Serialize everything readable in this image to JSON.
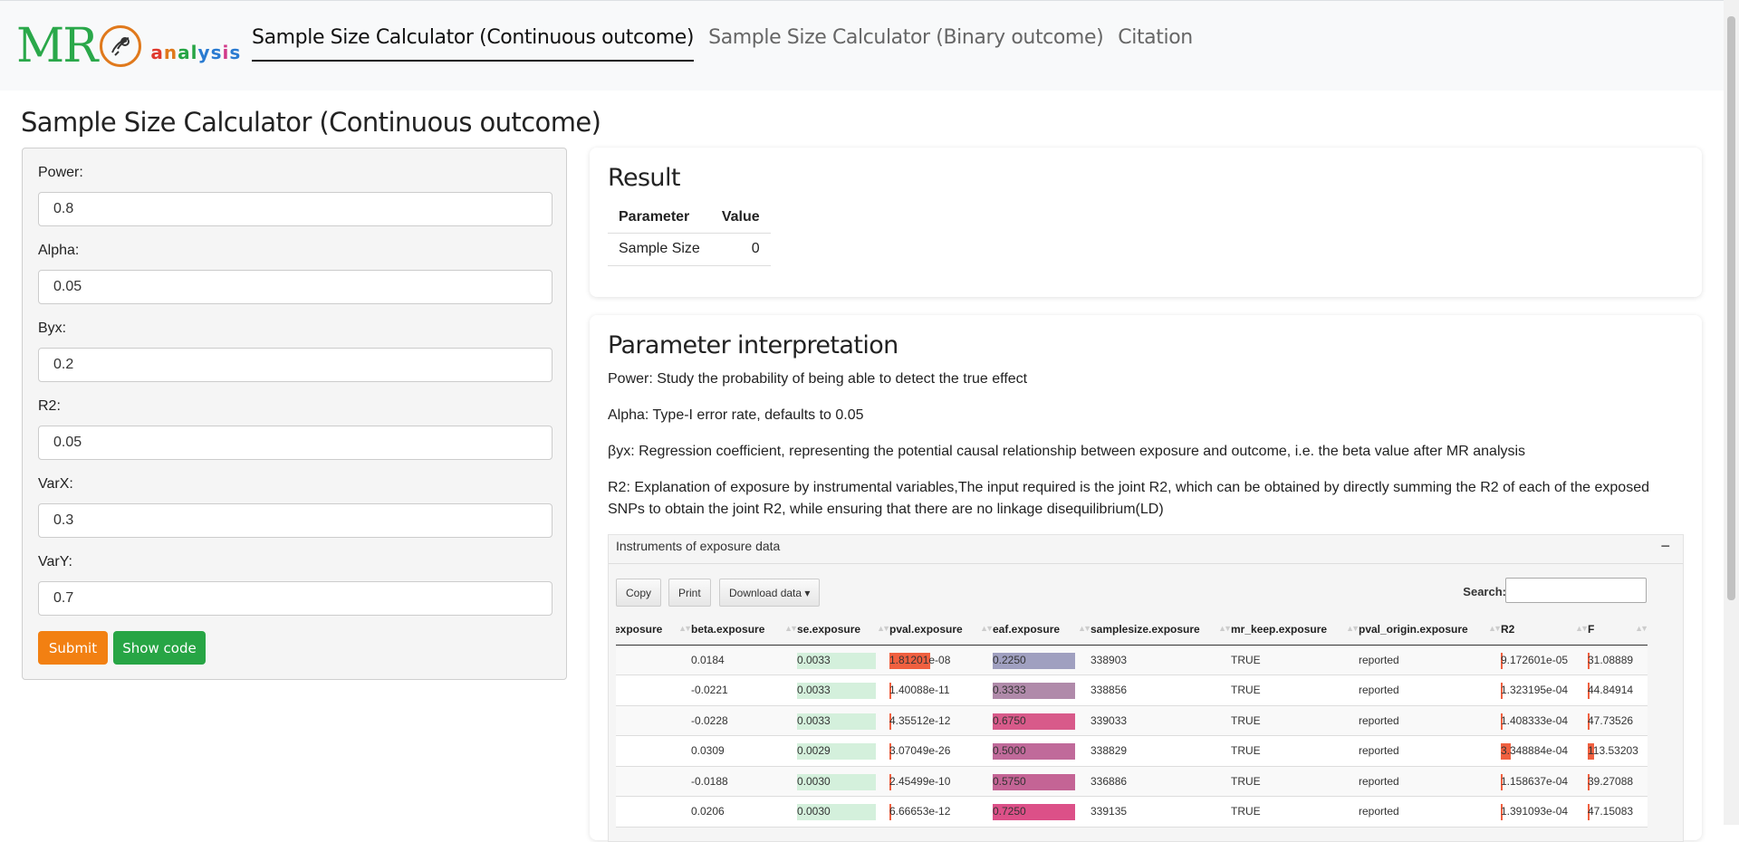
{
  "logo": {
    "mr": "MR",
    "symbol": "⚲",
    "analysis_letters": [
      "a",
      "n",
      "a",
      "l",
      "y",
      "s",
      "i",
      "s"
    ],
    "analysis_colors": [
      "#e03a2f",
      "#e0791c",
      "#27a545",
      "#27a545",
      "#2a7bd1",
      "#2a7bd1",
      "#d13a8a",
      "#2a7bd1"
    ]
  },
  "nav": {
    "items": [
      "Sample Size Calculator (Continuous outcome)",
      "Sample Size Calculator (Binary outcome)",
      "Citation"
    ],
    "active": 0
  },
  "page_title": "Sample Size Calculator (Continuous outcome)",
  "form": {
    "fields": [
      {
        "label": "Power:",
        "value": "0.8"
      },
      {
        "label": "Alpha:",
        "value": "0.05"
      },
      {
        "label": "Byx:",
        "value": "0.2"
      },
      {
        "label": "R2:",
        "value": "0.05"
      },
      {
        "label": "VarX:",
        "value": "0.3"
      },
      {
        "label": "VarY:",
        "value": "0.7"
      }
    ],
    "submit_label": "Submit",
    "show_code_label": "Show code",
    "submit_color": "#f28012",
    "show_code_color": "#27a545"
  },
  "result": {
    "title": "Result",
    "headers": [
      "Parameter",
      "Value"
    ],
    "rows": [
      [
        "Sample Size",
        "0"
      ]
    ]
  },
  "interpretation": {
    "title": "Parameter interpretation",
    "paragraphs": [
      "Power: Study the probability of being able to detect the true effect",
      "Alpha: Type-I error rate, defaults to 0.05",
      "βyx: Regression coefficient, representing the potential causal relationship between exposure and outcome, i.e. the beta value after MR analysis",
      "R2: Explanation of exposure by instrumental variables,The input required is the joint R2, which can be obtained by directly summing the R2 of each of the exposed SNPs to obtain the joint R2, while ensuring that there are no linkage disequilibrium(LD)"
    ]
  },
  "instruments": {
    "panel_title": "Instruments of exposure data",
    "collapse_symbol": "−",
    "buttons": [
      "Copy",
      "Print",
      "Download data ▾"
    ],
    "search_label": "Search:",
    "columns": [
      "exposure",
      "beta.exposure",
      "se.exposure",
      "pval.exposure",
      "eaf.exposure",
      "samplesize.exposure",
      "mr_keep.exposure",
      "pval_origin.exposure",
      "R2",
      "F"
    ],
    "rows": [
      {
        "exposure": "",
        "beta": "0.0184",
        "se": "0.0033",
        "pval": "1.81201e-08",
        "pval_level": 0.45,
        "eaf": "0.2250",
        "eaf_color": "#a0a0c0",
        "samplesize": "338903",
        "mr_keep": "TRUE",
        "pval_origin": "reported",
        "r2": "9.172601e-05",
        "r2_level": 0.01,
        "f": "31.08889",
        "f_level": 0.02
      },
      {
        "exposure": "",
        "beta": "-0.0221",
        "se": "0.0033",
        "pval": "1.40088e-11",
        "pval_level": 0.02,
        "eaf": "0.3333",
        "eaf_color": "#b08aaa",
        "samplesize": "338856",
        "mr_keep": "TRUE",
        "pval_origin": "reported",
        "r2": "1.323195e-04",
        "r2_level": 0.02,
        "f": "44.84914",
        "f_level": 0.02
      },
      {
        "exposure": "",
        "beta": "-0.0228",
        "se": "0.0033",
        "pval": "4.35512e-12",
        "pval_level": 0.02,
        "eaf": "0.6750",
        "eaf_color": "#d85a8a",
        "samplesize": "339033",
        "mr_keep": "TRUE",
        "pval_origin": "reported",
        "r2": "1.408333e-04",
        "r2_level": 0.02,
        "f": "47.73526",
        "f_level": 0.02
      },
      {
        "exposure": "",
        "beta": "0.0309",
        "se": "0.0029",
        "pval": "3.07049e-26",
        "pval_level": 0.02,
        "eaf": "0.5000",
        "eaf_color": "#c06a9a",
        "samplesize": "338829",
        "mr_keep": "TRUE",
        "pval_origin": "reported",
        "r2": "3.348884e-04",
        "r2_level": 0.12,
        "f": "113.53203",
        "f_level": 0.12
      },
      {
        "exposure": "",
        "beta": "-0.0188",
        "se": "0.0030",
        "pval": "2.45499e-10",
        "pval_level": 0.02,
        "eaf": "0.5750",
        "eaf_color": "#c46495",
        "samplesize": "336886",
        "mr_keep": "TRUE",
        "pval_origin": "reported",
        "r2": "1.158637e-04",
        "r2_level": 0.02,
        "f": "39.27088",
        "f_level": 0.02
      },
      {
        "exposure": "",
        "beta": "0.0206",
        "se": "0.0030",
        "pval": "6.66653e-12",
        "pval_level": 0.02,
        "eaf": "0.7250",
        "eaf_color": "#dc5088",
        "samplesize": "339135",
        "mr_keep": "TRUE",
        "pval_origin": "reported",
        "r2": "1.391093e-04",
        "r2_level": 0.02,
        "f": "47.15083",
        "f_level": 0.02
      }
    ],
    "se_bar_color": "#d4f0dc",
    "pval_bar_color": "#f06040",
    "r2_bar_color": "#f06040"
  }
}
